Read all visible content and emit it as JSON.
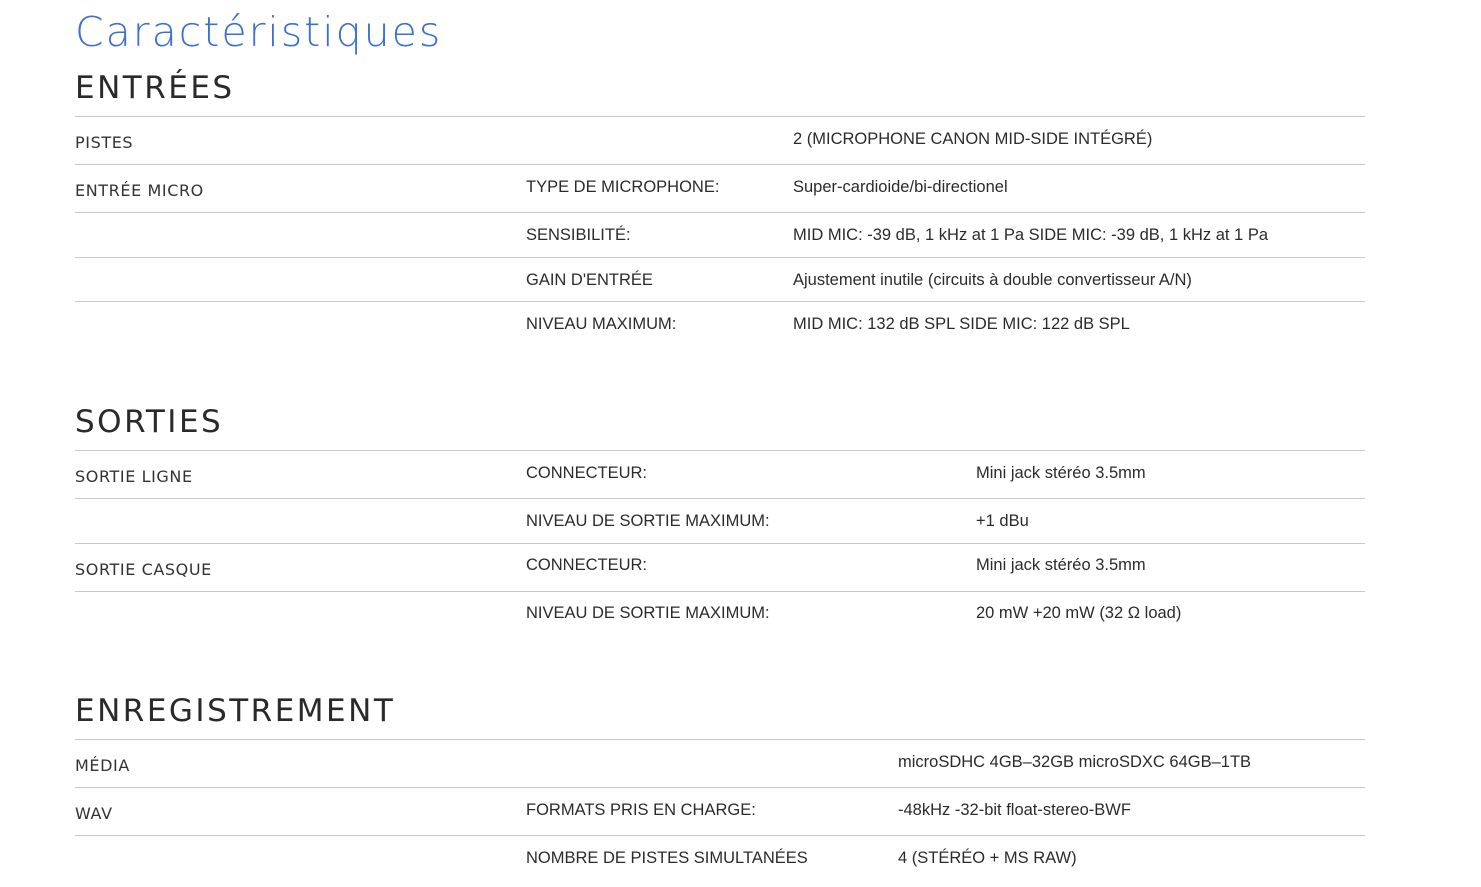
{
  "page_title": "Caractéristiques",
  "sections": {
    "inputs": {
      "heading": "ENTRÉES",
      "rows": [
        {
          "label": "PISTES",
          "param": "",
          "value": "2 (MICROPHONE CANON MID-SIDE INTÉGRÉ)"
        },
        {
          "label": "ENTRÉE MICRO",
          "param": "TYPE DE MICROPHONE:",
          "value": "Super-cardioide/bi-directionel"
        },
        {
          "label": "",
          "param": "SENSIBILITÉ:",
          "value": "MID MIC: -39 dB, 1 kHz at 1 Pa SIDE MIC: -39 dB, 1 kHz at 1 Pa"
        },
        {
          "label": "",
          "param": "GAIN D'ENTRÉE",
          "value": "Ajustement inutile (circuits à double convertisseur A/N)"
        },
        {
          "label": "",
          "param": "NIVEAU MAXIMUM:",
          "value": "MID MIC: 132 dB SPL SIDE MIC: 122 dB SPL"
        }
      ]
    },
    "outputs": {
      "heading": "SORTIES",
      "rows": [
        {
          "label": "SORTIE LIGNE",
          "param": "CONNECTEUR:",
          "value": "Mini jack stéréo 3.5mm"
        },
        {
          "label": "",
          "param": "NIVEAU DE SORTIE MAXIMUM:",
          "value": "+1 dBu"
        },
        {
          "label": "SORTIE CASQUE",
          "param": "CONNECTEUR:",
          "value": "Mini jack stéréo 3.5mm"
        },
        {
          "label": "",
          "param": "NIVEAU DE SORTIE MAXIMUM:",
          "value": "20 mW +20 mW (32 Ω load)"
        }
      ]
    },
    "recording": {
      "heading": "ENREGISTREMENT",
      "rows": [
        {
          "label": "MÉDIA",
          "param": "",
          "value": "microSDHC 4GB–32GB microSDXC 64GB–1TB"
        },
        {
          "label": "WAV",
          "param": "FORMATS PRIS EN CHARGE:",
          "value": "-48kHz -32-bit float-stereo-BWF"
        },
        {
          "label": "",
          "param": "NOMBRE DE PISTES SIMULTANÉES",
          "value": "4 (STÉRÉO + MS RAW)"
        }
      ]
    }
  },
  "colors": {
    "title": "#3a6fd8",
    "rule": "#c9c9c9",
    "text": "#2b2b2b"
  }
}
